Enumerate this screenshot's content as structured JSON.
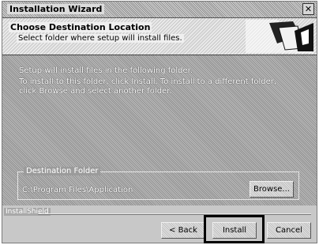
{
  "window": {
    "title": "Installation Wizard"
  },
  "header": {
    "title": "Choose Destination Location",
    "subtitle": "Select folder where setup will install files."
  },
  "body": {
    "path_label": "Setup will install files in the following folder.",
    "description": "To install to this folder, click Install. To install to a different folder, click Browse and select another folder."
  },
  "destination": {
    "group_label": "Destination Folder",
    "path": "C:\\Program Files\\Application",
    "browse_label": "Browse..."
  },
  "footer": {
    "separator_label": "InstallShield",
    "back_label": "< Back",
    "install_label": "Install",
    "cancel_label": "Cancel"
  }
}
